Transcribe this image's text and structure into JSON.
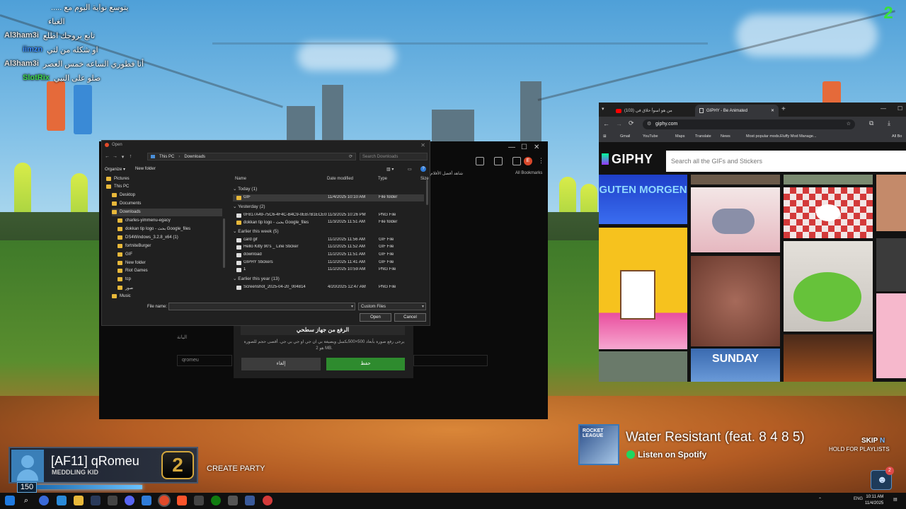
{
  "chat": {
    "messages": [
      {
        "user": "",
        "text": "..... يتوسع نواية اليوم مع"
      },
      {
        "user": "",
        "text": "الغباء"
      },
      {
        "user": "Al3ham3i",
        "text": "تابع بروجك اطلع"
      },
      {
        "user": "iimzn",
        "text": "او شكله من لتي"
      },
      {
        "user": "Al3ham3i",
        "text": "أنا فطوري الساعه خمس العصر"
      },
      {
        "user": "SlotRix",
        "text": "صلو على النبي"
      }
    ]
  },
  "overlay": {
    "corner_logo": "2"
  },
  "chrome_back": {
    "bookmarks_label": "All Bookmarks",
    "bookmark_ar": "شاهد أفضل الأفلام",
    "profile_letter": "E",
    "upload_title": "الرفع من جهاز سطحي",
    "upload_desc": "يرجى رفع صورة بأبعاد 500×500بكسل ويصيغة بي ان جي او جي بي جي. أقصى حجم للصورة هو 2 MB.",
    "cancel_label": "إلغاء",
    "save_label": "حفظ",
    "field_label": "اليانة",
    "field_value": "qromeu"
  },
  "dialog": {
    "title": "Open",
    "breadcrumb": [
      "This PC",
      "Downloads"
    ],
    "search_placeholder": "Search Downloads",
    "organize_label": "Organize",
    "new_folder_label": "New folder",
    "sidebar": [
      {
        "label": "Pictures",
        "indent": 0,
        "selected": false
      },
      {
        "label": "This PC",
        "indent": 0,
        "selected": false
      },
      {
        "label": "Desktop",
        "indent": 1,
        "selected": false
      },
      {
        "label": "Documents",
        "indent": 1,
        "selected": false
      },
      {
        "label": "Downloads",
        "indent": 1,
        "selected": true
      },
      {
        "label": "charles-yimmenu-egacy",
        "indent": 2,
        "selected": false
      },
      {
        "label": "dokkan tip logo - بحث Google_files",
        "indent": 2,
        "selected": false
      },
      {
        "label": "DS4Windows_3.2.8_x64 (1)",
        "indent": 2,
        "selected": false
      },
      {
        "label": "fortniteBurger",
        "indent": 2,
        "selected": false
      },
      {
        "label": "GIF",
        "indent": 2,
        "selected": false
      },
      {
        "label": "New folder",
        "indent": 2,
        "selected": false
      },
      {
        "label": "Riot Games",
        "indent": 2,
        "selected": false
      },
      {
        "label": "tcp",
        "indent": 2,
        "selected": false
      },
      {
        "label": "صور",
        "indent": 2,
        "selected": false
      },
      {
        "label": "Music",
        "indent": 1,
        "selected": false
      }
    ],
    "columns": [
      "Name",
      "Date modified",
      "Type",
      "Size"
    ],
    "groups": [
      {
        "label": "Today (1)",
        "rows": [
          {
            "name": "GIF",
            "date": "11/4/2025 10:10 AM",
            "type": "File folder",
            "kind": "folder",
            "selected": true
          }
        ]
      },
      {
        "label": "Yesterday (2)",
        "rows": [
          {
            "name": "0F817A49-75C6-4F4C-B4C9-0EB7B1ECE0F2",
            "date": "11/3/2025 10:26 PM",
            "type": "PNG File",
            "kind": "file",
            "selected": false
          },
          {
            "name": "dokkan tip logo - بحث Google_files",
            "date": "11/3/2025 11:51 AM",
            "type": "File folder",
            "kind": "folder",
            "selected": false
          }
        ]
      },
      {
        "label": "Earlier this week (5)",
        "rows": [
          {
            "name": "card gif",
            "date": "11/2/2025 11:56 AM",
            "type": "GIF File",
            "kind": "file",
            "selected": false
          },
          {
            "name": "Hello Kitty 90's _ Line Sticker",
            "date": "11/2/2025 11:52 AM",
            "type": "GIF File",
            "kind": "file",
            "selected": false
          },
          {
            "name": "download",
            "date": "11/2/2025 11:51 AM",
            "type": "GIF File",
            "kind": "file",
            "selected": false
          },
          {
            "name": "GIPHY Stickers",
            "date": "11/2/2025 11:41 AM",
            "type": "GIF File",
            "kind": "file",
            "selected": false
          },
          {
            "name": "1",
            "date": "11/2/2025 10:59 AM",
            "type": "PNG File",
            "kind": "file",
            "selected": false
          }
        ]
      },
      {
        "label": "Earlier this year (13)",
        "rows": [
          {
            "name": "Screenshot_2025-04-20_004814",
            "date": "4/20/2025 12:47 AM",
            "type": "PNG File",
            "kind": "file",
            "selected": false
          }
        ]
      }
    ],
    "filename_label": "File name:",
    "filename_value": "",
    "filter_value": "Custom Files",
    "open_label": "Open",
    "cancel_label": "Cancel"
  },
  "giphy": {
    "tabs": [
      {
        "label": "(103) من هو اسوأ حلاق في",
        "active": false
      },
      {
        "label": "GIPHY - Be Animated",
        "active": true
      }
    ],
    "url": "giphy.com",
    "bookmarks": [
      "Gmail",
      "YouTube",
      "Maps",
      "Translate",
      "News",
      "Most popular mods...",
      "Fluffy Mod Manage...",
      "All Bo"
    ],
    "logo": "GIPHY",
    "search_placeholder": "Search all the GIFs and Stickers",
    "gif_texts": [
      "GUTEN MORGEN",
      "SUNDAY"
    ]
  },
  "spotify": {
    "title": "Water Resistant (feat. 8 4 8 5)",
    "subtitle": "Listen on Spotify",
    "skip": "SKIP",
    "skip_key": "N",
    "hold": "HOLD FOR PLAYLISTS",
    "album_text": "ROCKET LEAGUE"
  },
  "player": {
    "name": "[AF11] qRomeu",
    "title": "MEDDLING KID",
    "rank": "2",
    "level": "150",
    "create_party": "CREATE PARTY",
    "friends_badge": "2",
    "xp_fraction": 0.62
  },
  "taskbar": {
    "tray_lang": "ENG",
    "time": "10:11 AM",
    "date": "11/4/2025"
  }
}
